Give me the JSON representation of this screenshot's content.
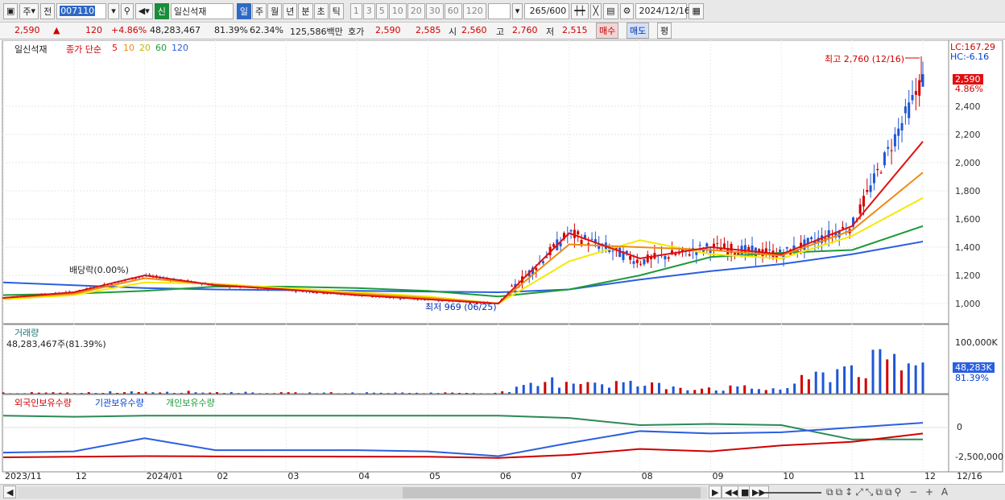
{
  "toolbar": {
    "market_type": "주",
    "prev_label": "전",
    "stock_code": "007110",
    "badge": "신",
    "stock_name": "일신석재",
    "periods": [
      "일",
      "주",
      "월",
      "년",
      "분",
      "초",
      "틱"
    ],
    "selected_period": "일",
    "intervals": [
      "1",
      "3",
      "5",
      "10",
      "20",
      "30",
      "60",
      "120"
    ],
    "count": "265",
    "count_total": "/600",
    "date": "2024/12/16"
  },
  "quote": {
    "price": "2,590",
    "arrow": "▲",
    "change": "120",
    "change_pct": "+4.86%",
    "volume": "48,283,467",
    "volume_ratio": "81.39%",
    "turnover": "62.34%",
    "amount": "125,586백만",
    "bid_ask_label": "호가",
    "ask": "2,590",
    "bid": "2,585",
    "open_label": "시",
    "open": "2,560",
    "high_label": "고",
    "high": "2,760",
    "low_label": "저",
    "low": "2,515",
    "buy_label": "매수",
    "sell_label": "매도",
    "eval_label": "평"
  },
  "price_panel": {
    "legend_name": "일신석재",
    "legend_ma": "종가 단순",
    "ma_periods": [
      "5",
      "10",
      "20",
      "60",
      "120"
    ],
    "lc": "LC:167.29",
    "hc": "HC:-6.16",
    "max_annot": "최고 2,760 (12/16)",
    "min_annot": "최저 969 (06/25)",
    "div_annot": "배당락(0.00%)",
    "price_tag": "2,590",
    "pct_tag": "4.86%"
  },
  "volume_panel": {
    "title": "거래량",
    "value": "48,283,467주(81.39%)",
    "axis_label": "100,000K",
    "tag": "48,283K",
    "tag_pct": "81.39%"
  },
  "holding_panel": {
    "legend": [
      "외국인보유수량",
      "기관보유수량",
      "개인보유수량"
    ],
    "axis": [
      "0",
      "-2,500,000"
    ]
  },
  "x_axis": [
    "2023/11",
    "12",
    "2024/01",
    "02",
    "03",
    "04",
    "05",
    "06",
    "07",
    "08",
    "09",
    "10",
    "11",
    "12",
    "12/16"
  ],
  "colors": {
    "up": "#d00000",
    "down": "#1e56d6",
    "ma5": "#e01010",
    "ma10": "#f08a10",
    "ma20": "#f5e800",
    "ma60": "#1e9a3a",
    "ma120": "#2a5fe0"
  },
  "chart_data": {
    "type": "candlestick",
    "x": [
      "2023/11",
      "12",
      "2024/01",
      "02",
      "03",
      "04",
      "05",
      "06",
      "07",
      "08",
      "09",
      "10",
      "11",
      "12"
    ],
    "price_axis": [
      1000,
      1200,
      1400,
      1600,
      1800,
      2000,
      2200,
      2400
    ],
    "close_monthly": [
      1040,
      1080,
      1200,
      1130,
      1100,
      1060,
      1030,
      1000,
      1500,
      1300,
      1400,
      1350,
      1550,
      2590
    ],
    "ma120_monthly": [
      1150,
      1130,
      1110,
      1100,
      1095,
      1090,
      1085,
      1080,
      1100,
      1170,
      1230,
      1280,
      1350,
      1440
    ],
    "ma60_monthly": [
      1060,
      1070,
      1090,
      1120,
      1120,
      1110,
      1090,
      1050,
      1100,
      1200,
      1330,
      1360,
      1380,
      1550
    ],
    "ma20_monthly": [
      1030,
      1060,
      1150,
      1140,
      1110,
      1080,
      1050,
      1000,
      1300,
      1450,
      1350,
      1320,
      1480,
      1750
    ],
    "ma10_monthly": [
      1040,
      1070,
      1180,
      1135,
      1100,
      1070,
      1040,
      1000,
      1420,
      1400,
      1380,
      1340,
      1520,
      1930
    ],
    "ma5_monthly": [
      1040,
      1080,
      1200,
      1130,
      1100,
      1060,
      1030,
      1000,
      1500,
      1320,
      1400,
      1350,
      1550,
      2150
    ],
    "volume_monthly_k": [
      2,
      2,
      5,
      3,
      2,
      2,
      2,
      2,
      30,
      18,
      12,
      10,
      60,
      55
    ],
    "foreign": [
      -2500000,
      -2450000,
      -2400000,
      -2420000,
      -2430000,
      -2440000,
      -2450000,
      -2550000,
      -2300000,
      -1800000,
      -2000000,
      -1500000,
      -1200000,
      -500000
    ],
    "institution": [
      -2100000,
      -2000000,
      -900000,
      -1900000,
      -1900000,
      -1900000,
      -2000000,
      -2400000,
      -1300000,
      -300000,
      -500000,
      -400000,
      0,
      400000
    ],
    "individual": [
      1000000,
      900000,
      1000000,
      1000000,
      1000000,
      1000000,
      1000000,
      1000000,
      800000,
      200000,
      300000,
      200000,
      -1000000,
      -1000000
    ]
  }
}
